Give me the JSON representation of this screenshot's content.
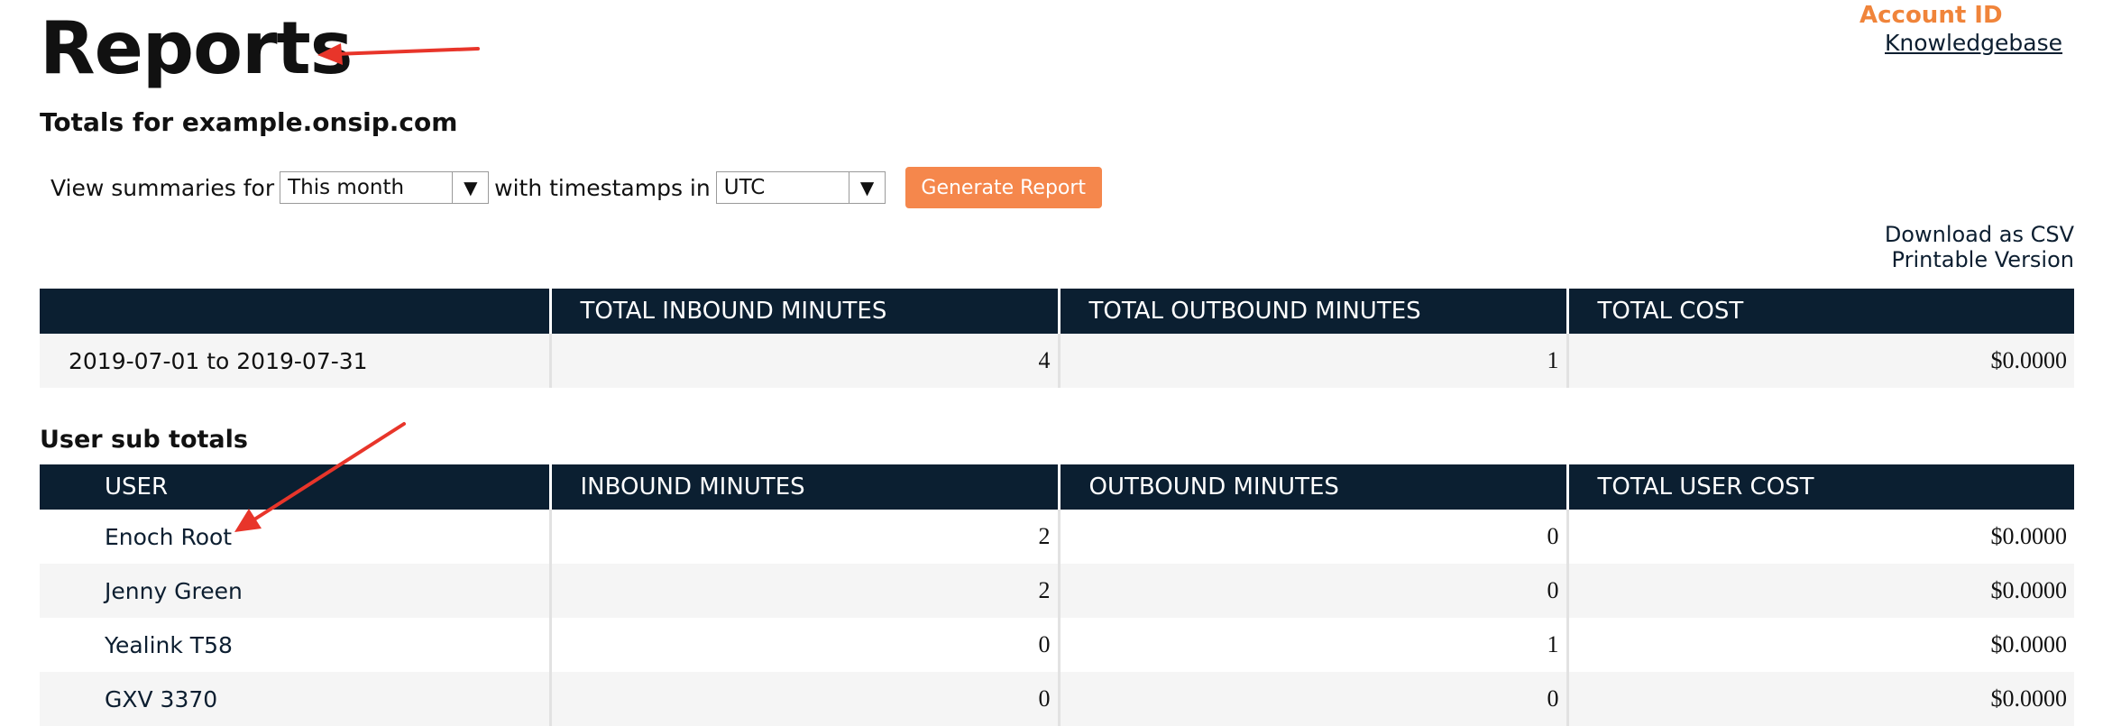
{
  "header": {
    "title": "Reports",
    "account_id_label": "Account ID",
    "knowledgebase_link": "Knowledgebase"
  },
  "totals_heading": "Totals for example.onsip.com",
  "filters": {
    "view_label": "View summaries for",
    "period_value": "This month",
    "timestamps_label": "with timestamps in",
    "timezone_value": "UTC",
    "generate_label": "Generate Report"
  },
  "export": {
    "csv_label": "Download as CSV",
    "printable_label": "Printable Version"
  },
  "summary_table": {
    "headers": [
      "",
      "TOTAL INBOUND MINUTES",
      "TOTAL OUTBOUND MINUTES",
      "TOTAL COST"
    ],
    "row": {
      "range": "2019-07-01 to 2019-07-31",
      "inbound": "4",
      "outbound": "1",
      "cost": "$0.0000"
    }
  },
  "users_heading": "User sub totals",
  "users_table": {
    "headers": [
      "USER",
      "INBOUND MINUTES",
      "OUTBOUND MINUTES",
      "TOTAL USER COST"
    ],
    "rows": [
      {
        "user": "Enoch Root",
        "inbound": "2",
        "outbound": "0",
        "cost": "$0.0000"
      },
      {
        "user": "Jenny Green",
        "inbound": "2",
        "outbound": "0",
        "cost": "$0.0000"
      },
      {
        "user": "Yealink T58",
        "inbound": "0",
        "outbound": "1",
        "cost": "$0.0000"
      },
      {
        "user": "GXV 3370",
        "inbound": "0",
        "outbound": "0",
        "cost": "$0.0000"
      }
    ]
  },
  "colors": {
    "accent": "#f5874c",
    "header_bg": "#0b1f31",
    "annotation_arrow": "#e8352a"
  },
  "icons": {
    "dropdown": "chevron-down-icon",
    "annotation": "arrow-icon"
  }
}
